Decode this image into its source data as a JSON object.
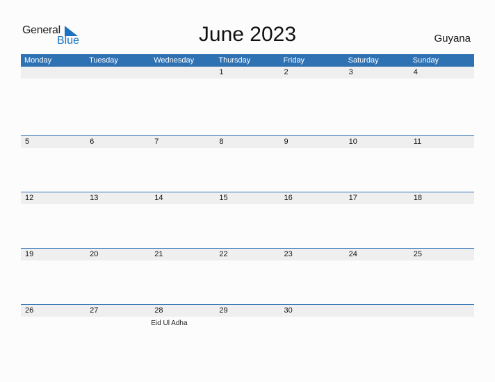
{
  "logo": {
    "general": "General",
    "blue": "Blue"
  },
  "title": "June 2023",
  "country": "Guyana",
  "colors": {
    "accent": "#2e72b4",
    "logo_blue": "#1a72c0",
    "row_bg": "#efefef"
  },
  "weekdays": [
    "Monday",
    "Tuesday",
    "Wednesday",
    "Thursday",
    "Friday",
    "Saturday",
    "Sunday"
  ],
  "weeks": [
    {
      "days": [
        "",
        "",
        "",
        "1",
        "2",
        "3",
        "4"
      ],
      "events": [
        "",
        "",
        "",
        "",
        "",
        "",
        ""
      ]
    },
    {
      "days": [
        "5",
        "6",
        "7",
        "8",
        "9",
        "10",
        "11"
      ],
      "events": [
        "",
        "",
        "",
        "",
        "",
        "",
        ""
      ]
    },
    {
      "days": [
        "12",
        "13",
        "14",
        "15",
        "16",
        "17",
        "18"
      ],
      "events": [
        "",
        "",
        "",
        "",
        "",
        "",
        ""
      ]
    },
    {
      "days": [
        "19",
        "20",
        "21",
        "22",
        "23",
        "24",
        "25"
      ],
      "events": [
        "",
        "",
        "",
        "",
        "",
        "",
        ""
      ]
    },
    {
      "days": [
        "26",
        "27",
        "28",
        "29",
        "30",
        "",
        ""
      ],
      "events": [
        "",
        "",
        "Eid Ul Adha",
        "",
        "",
        "",
        ""
      ]
    }
  ]
}
